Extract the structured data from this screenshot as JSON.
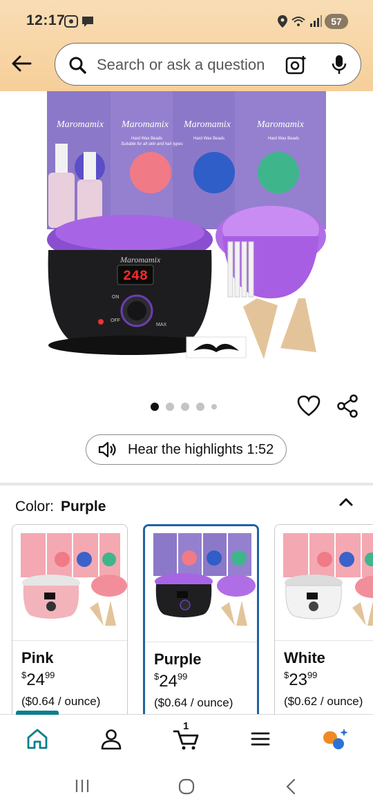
{
  "status_bar": {
    "time": "12:17",
    "battery": "57"
  },
  "search": {
    "placeholder": "Search or ask a question"
  },
  "product_image": {
    "brand": "Maromamix",
    "display_readout": "248",
    "packs": [
      "Maromamix",
      "Maromamix",
      "Maromamix",
      "Maromamix"
    ],
    "pack_subtitle": "Hard Wax Beads",
    "pack_caption": "Suitable for all skin and hair types",
    "knob_on": "ON",
    "knob_off": "OFF",
    "knob_max": "MAX"
  },
  "carousel": {
    "count": 5,
    "active_index": 0
  },
  "hear_highlights": {
    "label": "Hear the highlights 1:52"
  },
  "color_selector": {
    "label": "Color:",
    "selected": "Purple",
    "options": [
      {
        "name": "Pink",
        "currency": "$",
        "whole": "24",
        "cents": "99",
        "unit_price": "($0.64 / ounce)",
        "warmer_color": "#f2b4ba"
      },
      {
        "name": "Purple",
        "currency": "$",
        "whole": "24",
        "cents": "99",
        "unit_price": "($0.64 / ounce)",
        "warmer_color": "#1f1f22"
      },
      {
        "name": "White",
        "currency": "$",
        "whole": "23",
        "cents": "99",
        "unit_price": "($0.62 / ounce)",
        "warmer_color": "#f2f2f2"
      }
    ]
  },
  "bottom_nav": {
    "items": [
      "home-icon",
      "account-icon",
      "cart-icon",
      "menu-icon",
      "rufus-icon"
    ],
    "cart_count": "1"
  },
  "colors": {
    "accent": "#0b7f8b",
    "selected_border": "#2162a1",
    "header_bg": "#f6cf99"
  }
}
